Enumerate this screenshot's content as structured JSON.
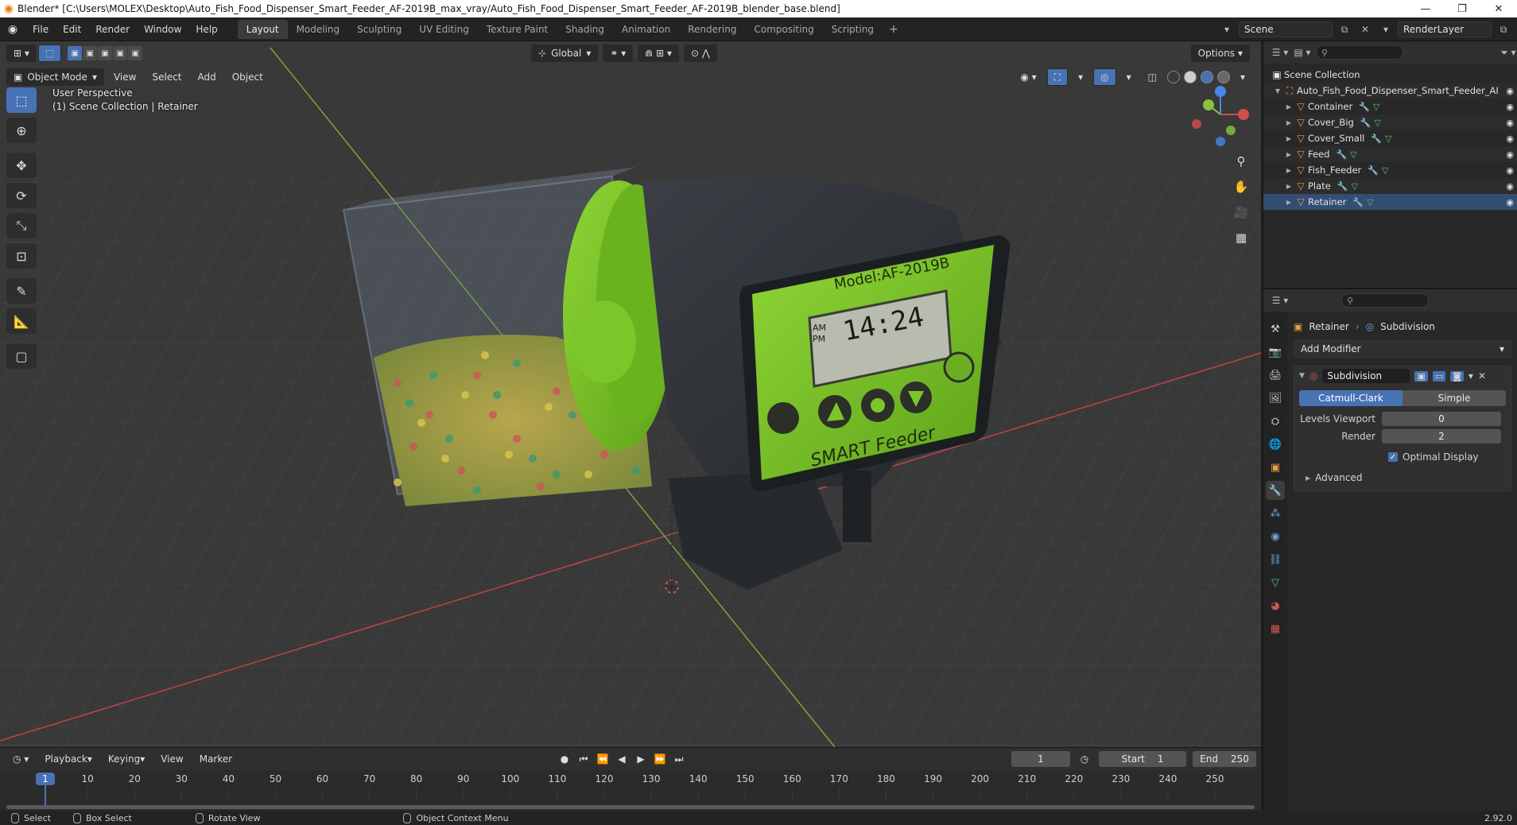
{
  "window": {
    "title": "Blender* [C:\\Users\\MOLEX\\Desktop\\Auto_Fish_Food_Dispenser_Smart_Feeder_AF-2019B_max_vray/Auto_Fish_Food_Dispenser_Smart_Feeder_AF-2019B_blender_base.blend]",
    "minimize": "—",
    "restore": "❐",
    "close": "✕"
  },
  "menu": [
    "File",
    "Edit",
    "Render",
    "Window",
    "Help"
  ],
  "workspaces": [
    "Layout",
    "Modeling",
    "Sculpting",
    "UV Editing",
    "Texture Paint",
    "Shading",
    "Animation",
    "Rendering",
    "Compositing",
    "Scripting"
  ],
  "active_workspace": "Layout",
  "scene_name": "Scene",
  "view_layer": "RenderLayer",
  "viewport": {
    "mode": "Object Mode",
    "menus": [
      "View",
      "Select",
      "Add",
      "Object"
    ],
    "orientation": "Global",
    "options_label": "Options",
    "perspective_label": "User Perspective",
    "collection_label": "(1) Scene Collection | Retainer"
  },
  "model_screen": {
    "model_text": "Model:AF-2019B",
    "time": "14:24",
    "am": "AM",
    "pm": "PM",
    "brand": "SMART Feeder"
  },
  "timeline": {
    "menus": [
      "Playback",
      "Keying",
      "View",
      "Marker"
    ],
    "current_frame": "1",
    "start_label": "Start",
    "start": "1",
    "end_label": "End",
    "end": "250",
    "ticks": [
      "1",
      "10",
      "20",
      "30",
      "40",
      "50",
      "60",
      "70",
      "80",
      "90",
      "100",
      "110",
      "120",
      "130",
      "140",
      "150",
      "160",
      "170",
      "180",
      "190",
      "200",
      "210",
      "220",
      "230",
      "240",
      "250"
    ]
  },
  "statusbar": {
    "select": "Select",
    "box_select": "Box Select",
    "rotate_view": "Rotate View",
    "context_menu": "Object Context Menu",
    "version": "2.92.0"
  },
  "outliner": {
    "root": "Scene Collection",
    "collection": "Auto_Fish_Food_Dispenser_Smart_Feeder_AI",
    "objects": [
      "Container",
      "Cover_Big",
      "Cover_Small",
      "Feed",
      "Fish_Feeder",
      "Plate",
      "Retainer"
    ],
    "selected": "Retainer"
  },
  "properties": {
    "object": "Retainer",
    "modifier_crumb": "Subdivision",
    "add_modifier": "Add Modifier",
    "modifier_name": "Subdivision",
    "algorithms": [
      "Catmull-Clark",
      "Simple"
    ],
    "active_algorithm": "Catmull-Clark",
    "levels_viewport_label": "Levels Viewport",
    "levels_viewport": "0",
    "render_label": "Render",
    "render": "2",
    "optimal_display": "Optimal Display",
    "advanced": "Advanced"
  },
  "colors": {
    "accent": "#4772b3",
    "feeder_green": "#7cc62a",
    "axis_x": "#c94a4a",
    "axis_y": "#8ac43f"
  }
}
